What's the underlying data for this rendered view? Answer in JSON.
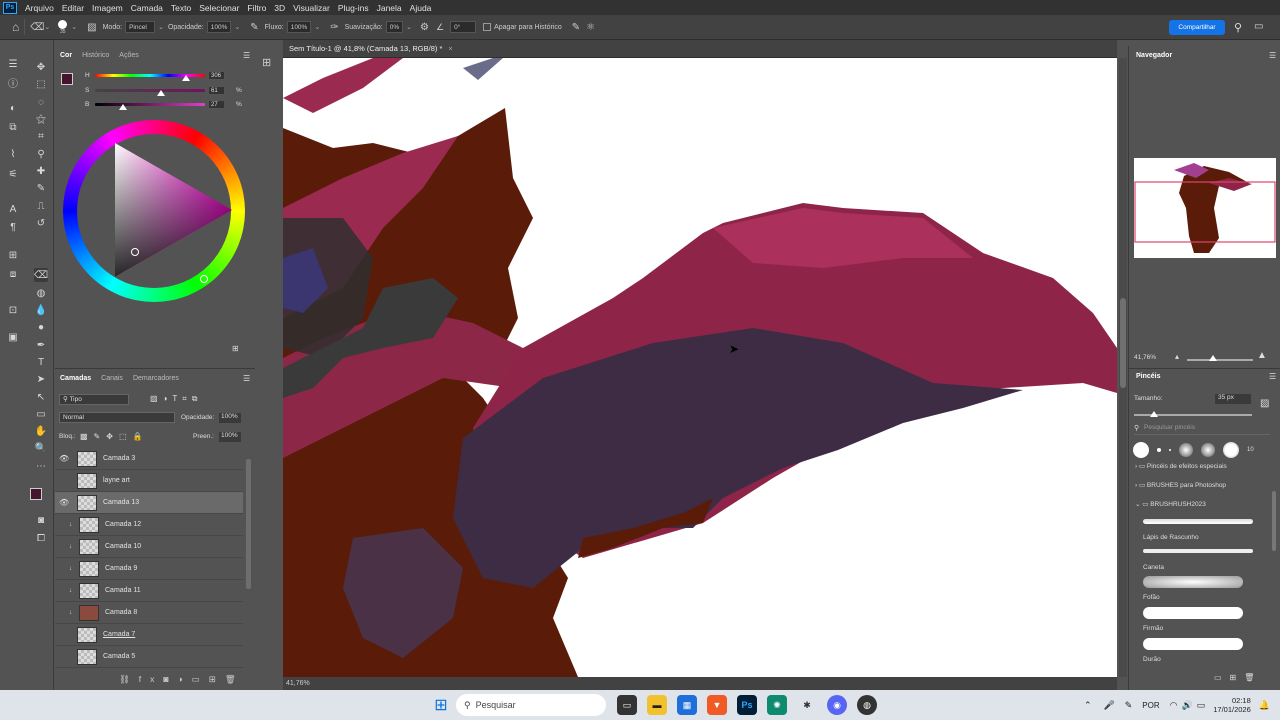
{
  "menu": {
    "items": [
      "Arquivo",
      "Editar",
      "Imagem",
      "Camada",
      "Texto",
      "Selecionar",
      "Filtro",
      "3D",
      "Visualizar",
      "Plug-ins",
      "Janela",
      "Ajuda"
    ]
  },
  "options": {
    "brush_size": "35",
    "mode_label": "Modo:",
    "mode_value": "Pincel",
    "opacity_label": "Opacidade:",
    "opacity_value": "100%",
    "flow_label": "Fluxo:",
    "flow_value": "100%",
    "smoothing_label": "Suavização:",
    "smoothing_value": "0%",
    "angle_value": "0°",
    "erase_history": "Apagar para Histórico",
    "share": "Compartilhar"
  },
  "color_panel": {
    "tabs": [
      "Cor",
      "Histórico",
      "Ações"
    ],
    "h_label": "H",
    "h_value": "306",
    "s_label": "S",
    "s_value": "61",
    "b_label": "B",
    "b_value": "27",
    "pct": "%"
  },
  "layers_panel": {
    "tabs": [
      "Camadas",
      "Canais",
      "Demarcadores"
    ],
    "filter": "Tipo",
    "blend": "Normal",
    "opacity_label": "Opacidade:",
    "opacity_value": "100%",
    "lock_label": "Bloq.:",
    "fill_label": "Preen.:",
    "fill_value": "100%",
    "layers": [
      {
        "name": "Camada 3"
      },
      {
        "name": "layne art"
      },
      {
        "name": "Camada 13"
      },
      {
        "name": "Camada 12"
      },
      {
        "name": "Camada 10"
      },
      {
        "name": "Camada 9"
      },
      {
        "name": "Camada 11"
      },
      {
        "name": "Camada 8"
      },
      {
        "name": "Camada 7"
      },
      {
        "name": "Camada 5"
      }
    ]
  },
  "document": {
    "tab_title": "Sem Título-1 @ 41,8% (Camada 13, RGB/8) *",
    "zoom_status": "41,76%"
  },
  "navigator": {
    "title": "Navegador",
    "zoom": "41,76%"
  },
  "brushes": {
    "title": "Pincéis",
    "size_label": "Tamanho:",
    "size_value": "35 px",
    "search_placeholder": "Pesquisar pincéis",
    "preset_size": "10",
    "folders": [
      "Pincéis de efeitos especiais",
      "BRUSHES para Photoshop",
      "BRUSHRUSH2023"
    ],
    "items": [
      "Lápis de Rascunho",
      "Caneta",
      "Fofão",
      "Firmão",
      "Durão"
    ]
  },
  "taskbar": {
    "search": "Pesquisar",
    "lang": "POR",
    "time": "02:18",
    "date": "17/01/2026"
  },
  "colors": {
    "accent": "#1473e6",
    "foreground": "#45142f"
  }
}
